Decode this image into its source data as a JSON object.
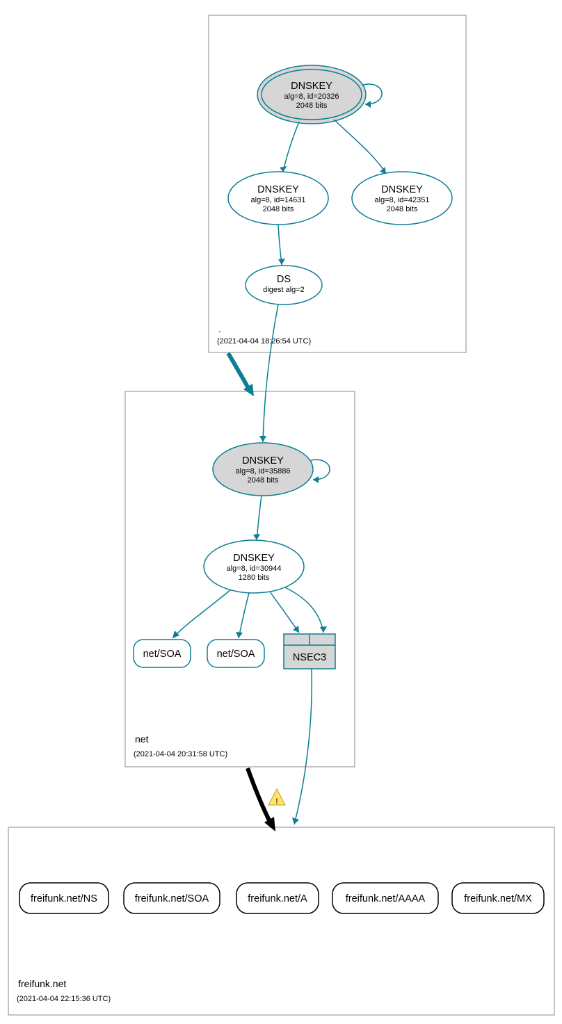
{
  "zones": {
    "root": {
      "name": ".",
      "timestamp": "(2021-04-04 18:26:54 UTC)"
    },
    "net": {
      "name": "net",
      "timestamp": "(2021-04-04 20:31:58 UTC)"
    },
    "freifunk": {
      "name": "freifunk.net",
      "timestamp": "(2021-04-04 22:15:36 UTC)"
    }
  },
  "nodes": {
    "root_ksk": {
      "title": "DNSKEY",
      "line1": "alg=8, id=20326",
      "line2": "2048 bits"
    },
    "root_zsk1": {
      "title": "DNSKEY",
      "line1": "alg=8, id=14631",
      "line2": "2048 bits"
    },
    "root_zsk2": {
      "title": "DNSKEY",
      "line1": "alg=8, id=42351",
      "line2": "2048 bits"
    },
    "root_ds": {
      "title": "DS",
      "line1": "digest alg=2"
    },
    "net_ksk": {
      "title": "DNSKEY",
      "line1": "alg=8, id=35886",
      "line2": "2048 bits"
    },
    "net_zsk": {
      "title": "DNSKEY",
      "line1": "alg=8, id=30944",
      "line2": "1280 bits"
    },
    "net_soa1": {
      "title": "net/SOA"
    },
    "net_soa2": {
      "title": "net/SOA"
    },
    "nsec3": {
      "title": "NSEC3"
    },
    "ff_ns": {
      "title": "freifunk.net/NS"
    },
    "ff_soa": {
      "title": "freifunk.net/SOA"
    },
    "ff_a": {
      "title": "freifunk.net/A"
    },
    "ff_aaaa": {
      "title": "freifunk.net/AAAA"
    },
    "ff_mx": {
      "title": "freifunk.net/MX"
    }
  }
}
